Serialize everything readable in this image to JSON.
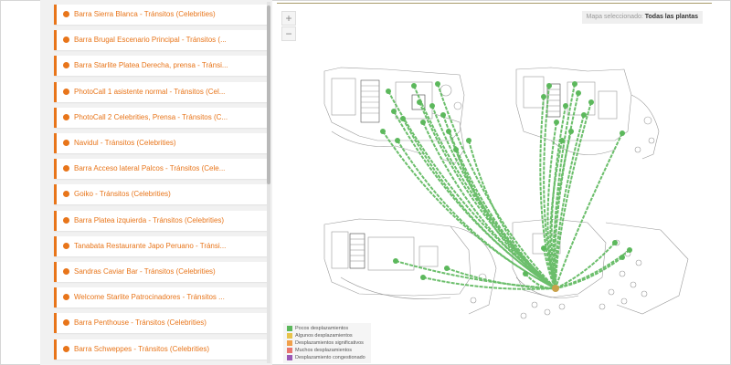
{
  "list": {
    "items": [
      {
        "label": "Barra Sierra Blanca - Tránsitos (Celebrities)"
      },
      {
        "label": "Barra Brugal Escenario Principal - Tránsitos (..."
      },
      {
        "label": "Barra Starlite Platea Derecha, prensa - Tránsi..."
      },
      {
        "label": "PhotoCall 1 asistente normal - Tránsitos (Cel..."
      },
      {
        "label": "PhotoCall 2 Celebrities, Prensa - Tránsitos (C..."
      },
      {
        "label": "Navidul - Tránsitos (Celebrities)"
      },
      {
        "label": "Barra Acceso lateral Palcos - Tránsitos (Cele..."
      },
      {
        "label": "Goiko - Tránsitos (Celebrities)"
      },
      {
        "label": "Barra Platea izquierda - Tránsitos (Celebrities)"
      },
      {
        "label": "Tanabata Restaurante Japo Peruano - Tránsi..."
      },
      {
        "label": "Sandras Caviar Bar - Tránsitos (Celebrities)"
      },
      {
        "label": "Welcome Starlite Patrocinadores - Tránsitos ..."
      },
      {
        "label": "Barra Penthouse - Tránsitos (Celebrities)"
      },
      {
        "label": "Barra Schweppes - Tránsitos (Celebrities)"
      }
    ]
  },
  "map": {
    "zoom_in": "+",
    "zoom_out": "−",
    "selected_caption": "Mapa seleccionado:",
    "selected_value": "Todas las plantas",
    "flow_color": "#5cb85c"
  },
  "legend": {
    "items": [
      {
        "label": "Pocos desplazamientos",
        "color": "#5cb85c"
      },
      {
        "label": "Algunos desplazamientos",
        "color": "#e8c34a"
      },
      {
        "label": "Desplazamientos significativos",
        "color": "#f0a04b"
      },
      {
        "label": "Muchos desplazamientos",
        "color": "#e8766f"
      },
      {
        "label": "Desplazamiento congestionado",
        "color": "#9b59b6"
      }
    ]
  }
}
